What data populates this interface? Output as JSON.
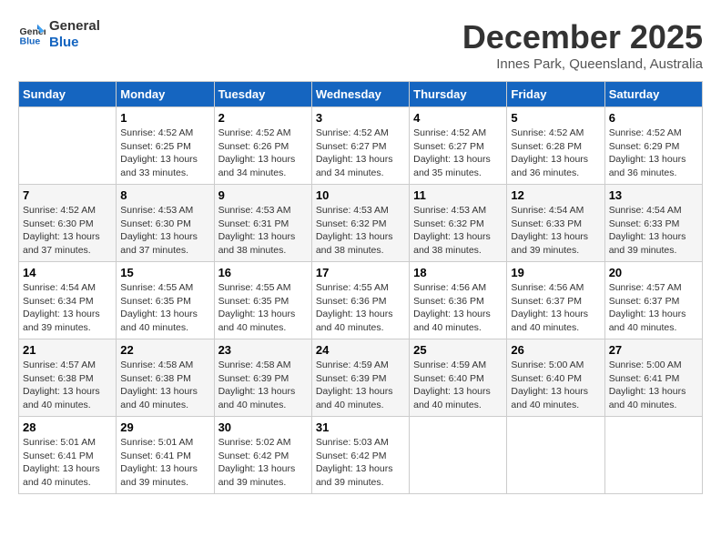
{
  "header": {
    "logo_line1": "General",
    "logo_line2": "Blue",
    "month": "December 2025",
    "location": "Innes Park, Queensland, Australia"
  },
  "weekdays": [
    "Sunday",
    "Monday",
    "Tuesday",
    "Wednesday",
    "Thursday",
    "Friday",
    "Saturday"
  ],
  "weeks": [
    [
      {
        "day": "",
        "content": ""
      },
      {
        "day": "1",
        "content": "Sunrise: 4:52 AM\nSunset: 6:25 PM\nDaylight: 13 hours\nand 33 minutes."
      },
      {
        "day": "2",
        "content": "Sunrise: 4:52 AM\nSunset: 6:26 PM\nDaylight: 13 hours\nand 34 minutes."
      },
      {
        "day": "3",
        "content": "Sunrise: 4:52 AM\nSunset: 6:27 PM\nDaylight: 13 hours\nand 34 minutes."
      },
      {
        "day": "4",
        "content": "Sunrise: 4:52 AM\nSunset: 6:27 PM\nDaylight: 13 hours\nand 35 minutes."
      },
      {
        "day": "5",
        "content": "Sunrise: 4:52 AM\nSunset: 6:28 PM\nDaylight: 13 hours\nand 36 minutes."
      },
      {
        "day": "6",
        "content": "Sunrise: 4:52 AM\nSunset: 6:29 PM\nDaylight: 13 hours\nand 36 minutes."
      }
    ],
    [
      {
        "day": "7",
        "content": "Sunrise: 4:52 AM\nSunset: 6:30 PM\nDaylight: 13 hours\nand 37 minutes."
      },
      {
        "day": "8",
        "content": "Sunrise: 4:53 AM\nSunset: 6:30 PM\nDaylight: 13 hours\nand 37 minutes."
      },
      {
        "day": "9",
        "content": "Sunrise: 4:53 AM\nSunset: 6:31 PM\nDaylight: 13 hours\nand 38 minutes."
      },
      {
        "day": "10",
        "content": "Sunrise: 4:53 AM\nSunset: 6:32 PM\nDaylight: 13 hours\nand 38 minutes."
      },
      {
        "day": "11",
        "content": "Sunrise: 4:53 AM\nSunset: 6:32 PM\nDaylight: 13 hours\nand 38 minutes."
      },
      {
        "day": "12",
        "content": "Sunrise: 4:54 AM\nSunset: 6:33 PM\nDaylight: 13 hours\nand 39 minutes."
      },
      {
        "day": "13",
        "content": "Sunrise: 4:54 AM\nSunset: 6:33 PM\nDaylight: 13 hours\nand 39 minutes."
      }
    ],
    [
      {
        "day": "14",
        "content": "Sunrise: 4:54 AM\nSunset: 6:34 PM\nDaylight: 13 hours\nand 39 minutes."
      },
      {
        "day": "15",
        "content": "Sunrise: 4:55 AM\nSunset: 6:35 PM\nDaylight: 13 hours\nand 40 minutes."
      },
      {
        "day": "16",
        "content": "Sunrise: 4:55 AM\nSunset: 6:35 PM\nDaylight: 13 hours\nand 40 minutes."
      },
      {
        "day": "17",
        "content": "Sunrise: 4:55 AM\nSunset: 6:36 PM\nDaylight: 13 hours\nand 40 minutes."
      },
      {
        "day": "18",
        "content": "Sunrise: 4:56 AM\nSunset: 6:36 PM\nDaylight: 13 hours\nand 40 minutes."
      },
      {
        "day": "19",
        "content": "Sunrise: 4:56 AM\nSunset: 6:37 PM\nDaylight: 13 hours\nand 40 minutes."
      },
      {
        "day": "20",
        "content": "Sunrise: 4:57 AM\nSunset: 6:37 PM\nDaylight: 13 hours\nand 40 minutes."
      }
    ],
    [
      {
        "day": "21",
        "content": "Sunrise: 4:57 AM\nSunset: 6:38 PM\nDaylight: 13 hours\nand 40 minutes."
      },
      {
        "day": "22",
        "content": "Sunrise: 4:58 AM\nSunset: 6:38 PM\nDaylight: 13 hours\nand 40 minutes."
      },
      {
        "day": "23",
        "content": "Sunrise: 4:58 AM\nSunset: 6:39 PM\nDaylight: 13 hours\nand 40 minutes."
      },
      {
        "day": "24",
        "content": "Sunrise: 4:59 AM\nSunset: 6:39 PM\nDaylight: 13 hours\nand 40 minutes."
      },
      {
        "day": "25",
        "content": "Sunrise: 4:59 AM\nSunset: 6:40 PM\nDaylight: 13 hours\nand 40 minutes."
      },
      {
        "day": "26",
        "content": "Sunrise: 5:00 AM\nSunset: 6:40 PM\nDaylight: 13 hours\nand 40 minutes."
      },
      {
        "day": "27",
        "content": "Sunrise: 5:00 AM\nSunset: 6:41 PM\nDaylight: 13 hours\nand 40 minutes."
      }
    ],
    [
      {
        "day": "28",
        "content": "Sunrise: 5:01 AM\nSunset: 6:41 PM\nDaylight: 13 hours\nand 40 minutes."
      },
      {
        "day": "29",
        "content": "Sunrise: 5:01 AM\nSunset: 6:41 PM\nDaylight: 13 hours\nand 39 minutes."
      },
      {
        "day": "30",
        "content": "Sunrise: 5:02 AM\nSunset: 6:42 PM\nDaylight: 13 hours\nand 39 minutes."
      },
      {
        "day": "31",
        "content": "Sunrise: 5:03 AM\nSunset: 6:42 PM\nDaylight: 13 hours\nand 39 minutes."
      },
      {
        "day": "",
        "content": ""
      },
      {
        "day": "",
        "content": ""
      },
      {
        "day": "",
        "content": ""
      }
    ]
  ]
}
